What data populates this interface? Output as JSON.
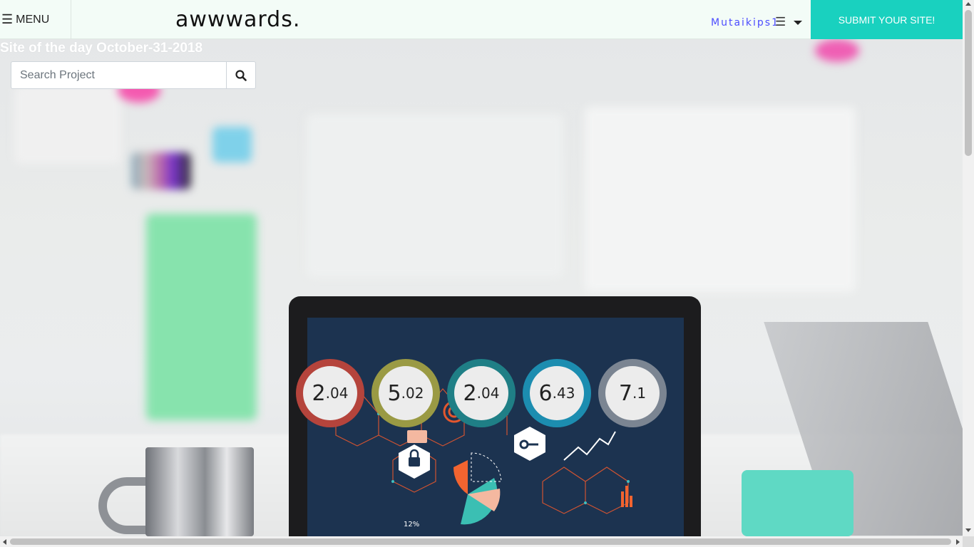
{
  "navbar": {
    "menu_label": "MENU",
    "brand": "awwwards.",
    "username": "Mutaikips1",
    "submit_label": "SUBMIT YOUR SITE!"
  },
  "hero": {
    "site_of_day": "Site of the day October-31-2018"
  },
  "search": {
    "placeholder": "Search Project"
  },
  "scores": [
    {
      "big": "2",
      "small": ".04",
      "ring": "#b5443c"
    },
    {
      "big": "5",
      "small": ".02",
      "ring": "#9a9a44"
    },
    {
      "big": "2",
      "small": ".04",
      "ring": "#1f7f86"
    },
    {
      "big": "6",
      "small": ".43",
      "ring": "#1c8db0"
    },
    {
      "big": "7",
      "small": ".1",
      "ring": "#7b8592"
    }
  ],
  "screen_label": "12%",
  "colors": {
    "navbar_bg": "#f3fcf7",
    "accent": "#19d1bf",
    "username": "#4c4cff"
  },
  "icons": [
    "hamburger-icon",
    "search-icon",
    "user-menu-icon",
    "caret-down-icon"
  ]
}
